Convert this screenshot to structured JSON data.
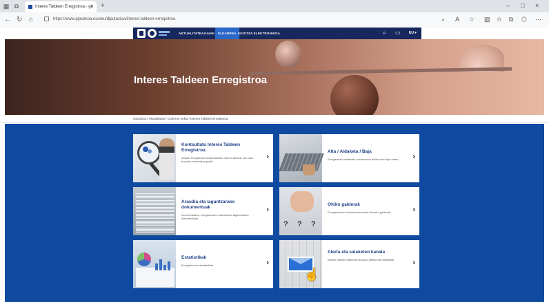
{
  "browser": {
    "tab_title": "Interes Taldeen Erregistroa - gu",
    "tab_close": "×",
    "new_tab": "+",
    "url": "https://www.gipuzkoa.eus/eu/diputazioa/interes-taldeen-erregistroa",
    "controls": {
      "minimize": "–",
      "maximize": "□",
      "close": "×"
    }
  },
  "site": {
    "menu": [
      {
        "label": "AKTUALITATEA"
      },
      {
        "label": "GAIAK"
      },
      {
        "label": "ELKARREA",
        "active": true
      },
      {
        "label": "EGOITZA ELEKTRONIKOA"
      }
    ],
    "language": "EU ▾"
  },
  "hero": {
    "title": "Interes Taldeen Erregistroa"
  },
  "breadcrumb": "Gipuzkoa / Aktualitatea / Gobernu Irekia / Interes Taldeen Erregistroa",
  "cards": [
    {
      "title": "Kontsultatu Interes Taldeen Erregistroa",
      "description": "Aurkitu erregistroan inskribatutako interes taldeak eta haiei buruzko informazio guztia.",
      "image": "magnifier-icon"
    },
    {
      "title": "Alta / Aldaketa / Baja",
      "description": "Erregistroan inskribatu, informazioa aldatu edo baja eman.",
      "image": "laptop-icon"
    },
    {
      "title": "Araudia eta laguntzarako dokumentuak",
      "description": "Interes taldeen erregistroaren araudia eta laguntzarako dokumentuak.",
      "image": "documents-icon"
    },
    {
      "title": "Ohiko galderak",
      "description": "Erregistroaren funtzionamenduari buruzko galderak.",
      "image": "question-icon"
    },
    {
      "title": "Estatistikak",
      "description": "Erregistroaren estatistikak.",
      "image": "stats-icon"
    },
    {
      "title": "Alerta eta salaketen kanala",
      "description": "Interes taldeen jardunari buruzko alertak eta salaketak.",
      "image": "mail-icon"
    }
  ],
  "chevron": "›"
}
